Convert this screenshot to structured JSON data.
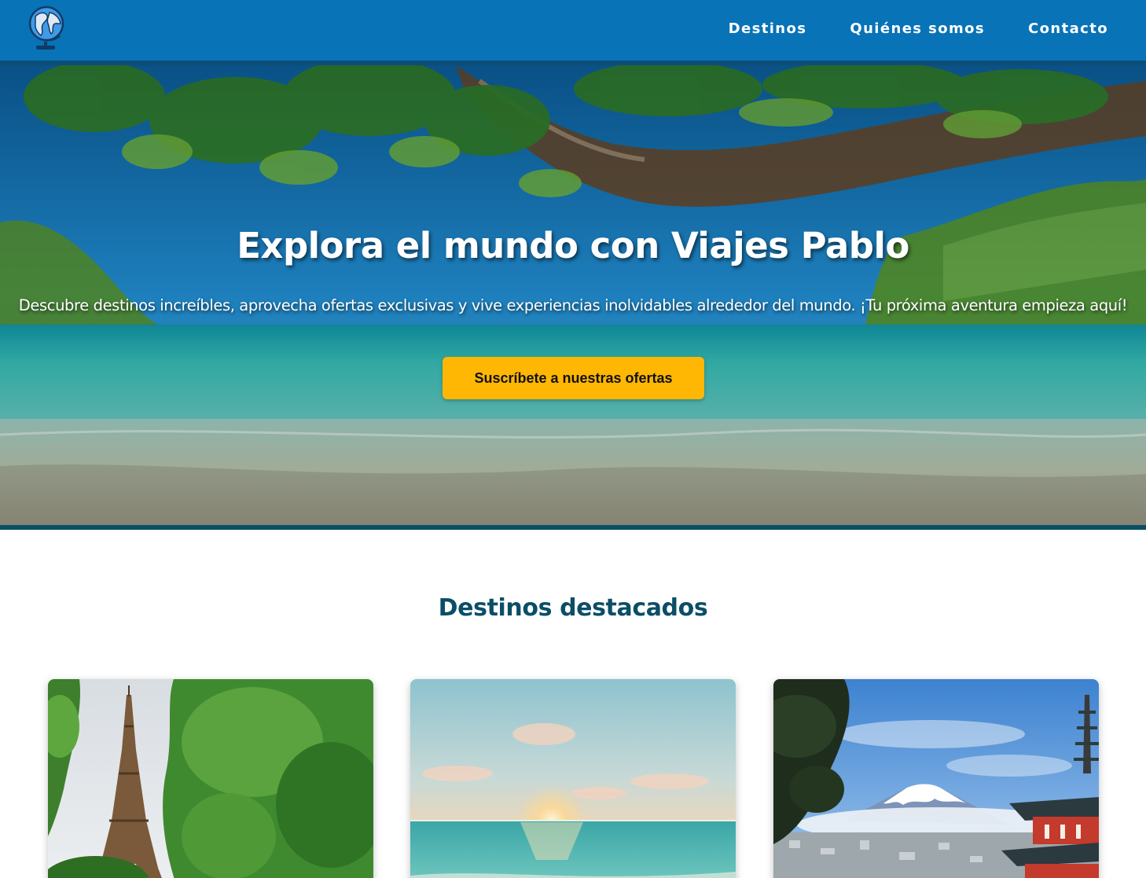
{
  "header": {
    "logo_icon": "globe-icon",
    "nav": [
      {
        "label": "Destinos"
      },
      {
        "label": "Quiénes somos"
      },
      {
        "label": "Contacto"
      }
    ]
  },
  "hero": {
    "title": "Explora el mundo con Viajes Pablo",
    "subtitle": "Descubre destinos increíbles, aprovecha ofertas exclusivas y vive experiencias inolvidables alrededor del mundo. ¡Tu próxima aventura empieza aquí!",
    "cta_label": "Suscríbete a nuestras ofertas",
    "background_image": "tropical-beach-photo"
  },
  "featured": {
    "title": "Destinos destacados",
    "cards": [
      {
        "image": "eiffel-tower-photo"
      },
      {
        "image": "beach-sunset-photo"
      },
      {
        "image": "mount-fuji-pagoda-photo"
      }
    ]
  },
  "colors": {
    "header_bg": "#0873b7",
    "header_strip": "#0b4e77",
    "accent": "#ffb703",
    "heading": "#0b4e66"
  }
}
